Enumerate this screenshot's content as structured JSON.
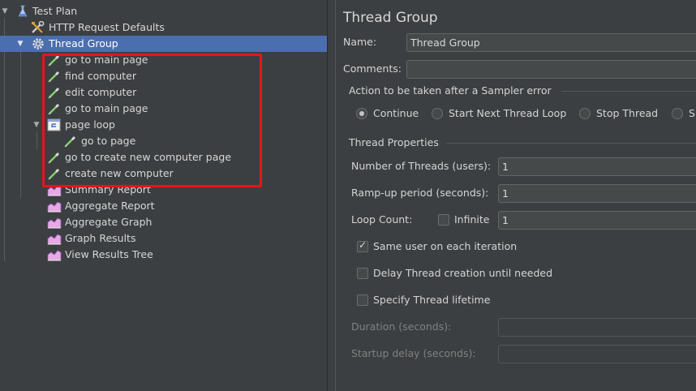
{
  "tree": {
    "items": [
      {
        "label": "Test Plan",
        "icon": "flask-icon"
      },
      {
        "label": "HTTP Request Defaults",
        "icon": "wrench-icon"
      },
      {
        "label": "Thread Group",
        "icon": "gear-icon"
      },
      {
        "label": "go to main page",
        "icon": "pipette-icon"
      },
      {
        "label": "find computer",
        "icon": "pipette-icon"
      },
      {
        "label": "edit computer",
        "icon": "pipette-icon"
      },
      {
        "label": "go to main page",
        "icon": "pipette-icon"
      },
      {
        "label": "page loop",
        "icon": "loop-controller-icon"
      },
      {
        "label": "go to page",
        "icon": "pipette-icon"
      },
      {
        "label": "go to create new computer page",
        "icon": "pipette-icon"
      },
      {
        "label": "create new computer",
        "icon": "pipette-icon"
      },
      {
        "label": "Summary Report",
        "icon": "report-chart-icon"
      },
      {
        "label": "Aggregate Report",
        "icon": "report-chart-icon"
      },
      {
        "label": "Aggregate Graph",
        "icon": "report-chart-icon"
      },
      {
        "label": "Graph Results",
        "icon": "report-chart-icon"
      },
      {
        "label": "View Results Tree",
        "icon": "report-chart-icon"
      }
    ],
    "selected_index": 2,
    "highlight_color": "#e8141b",
    "selection_color": "#4b6eaf"
  },
  "panel": {
    "title": "Thread Group",
    "name_label": "Name:",
    "name_value": "Thread Group",
    "comments_label": "Comments:",
    "comments_value": "",
    "sampler_error": {
      "heading": "Action to be taken after a Sampler error",
      "options": [
        "Continue",
        "Start Next Thread Loop",
        "Stop Thread",
        "S"
      ],
      "selected": "Continue"
    },
    "thread_properties": {
      "heading": "Thread Properties",
      "num_threads_label": "Number of Threads (users):",
      "num_threads_value": "1",
      "ramp_up_label": "Ramp-up period (seconds):",
      "ramp_up_value": "1",
      "loop_count_label": "Loop Count:",
      "infinite_label": "Infinite",
      "infinite_checked": false,
      "loop_count_value": "1",
      "same_user_label": "Same user on each iteration",
      "same_user_checked": true,
      "delay_creation_label": "Delay Thread creation until needed",
      "delay_creation_checked": false,
      "specify_lifetime_label": "Specify Thread lifetime",
      "specify_lifetime_checked": false,
      "duration_label": "Duration (seconds):",
      "duration_value": "",
      "startup_delay_label": "Startup delay (seconds):",
      "startup_delay_value": ""
    }
  }
}
